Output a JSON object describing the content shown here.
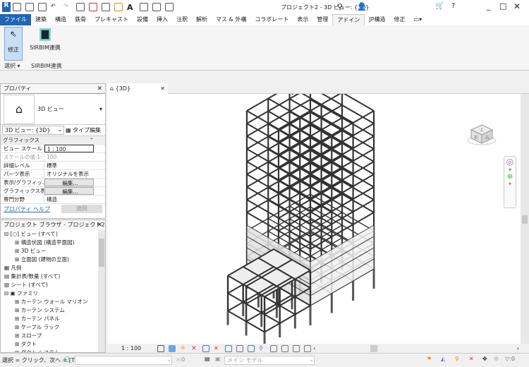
{
  "app": {
    "title": "プロジェクト2 - 3D ビュー: {3D}",
    "logo": "R"
  },
  "tabs": [
    "ファイル",
    "建築",
    "構造",
    "鉄骨",
    "プレキャスト",
    "設備",
    "挿入",
    "注釈",
    "解析",
    "マス & 外構",
    "コラボレート",
    "表示",
    "管理",
    "アドイン",
    "JP構造",
    "修正"
  ],
  "active_tab": "アドイン",
  "ribbon": {
    "modify": "修正",
    "select": "選択 ▾",
    "sirbim_button": "SIRBIM連携",
    "sirbim_panel": "SIRBIM連携"
  },
  "properties": {
    "title": "プロパティ",
    "type_name": "3D ビュー",
    "view_selector": "3D ビュー: {3D}",
    "edit_type": "タイプ編集",
    "group": "グラフィックス",
    "rows": [
      {
        "k": "ビュー スケール",
        "v": "1 : 100"
      },
      {
        "k": "スケールの値   1:",
        "v": "100"
      },
      {
        "k": "詳細レベル",
        "v": "標準"
      },
      {
        "k": "パーツ表示",
        "v": "オリジナルを表示"
      },
      {
        "k": "表示/グラフィッ...",
        "v": "編集..."
      },
      {
        "k": "グラフィックス表...",
        "v": "編集..."
      },
      {
        "k": "専門分野",
        "v": "構造"
      }
    ],
    "help": "プロパティ ヘルプ",
    "apply": "適用"
  },
  "browser": {
    "title": "プロジェクト ブラウザ - プロジェクト2",
    "items": [
      "ビュー (すべて)",
      "構造伏図 (構造平面図)",
      "3D ビュー",
      "立面図 (建物の立面)",
      "凡例",
      "集計表/数量 (すべて)",
      "シート (すべて)",
      "ファミリ",
      "カーテン ウォール マリオン",
      "カーテン システム",
      "カーテン パネル",
      "ケーブル ラック",
      "スロープ",
      "ダクト",
      "ダクト システム"
    ]
  },
  "view": {
    "tab": "{3D}",
    "scale": "1 : 100",
    "cube_faces": [
      "上",
      "前",
      "右"
    ]
  },
  "status": {
    "hint": "選択 = クリック、次へ = [T:",
    "count1": ":0",
    "model": "メイン モデル",
    "filter": ":0"
  }
}
